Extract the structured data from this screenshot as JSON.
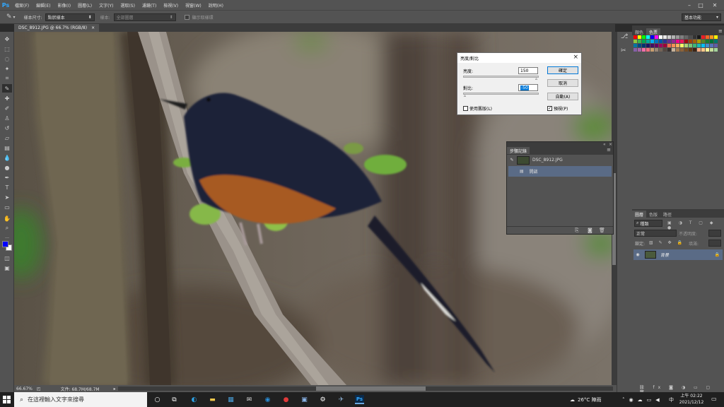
{
  "app": {
    "logo": "Ps"
  },
  "menu": [
    "檔案(F)",
    "編輯(E)",
    "影像(I)",
    "圖層(L)",
    "文字(Y)",
    "選取(S)",
    "濾鏡(T)",
    "檢視(V)",
    "視窗(W)",
    "說明(H)"
  ],
  "window_controls": {
    "minimize": "–",
    "maximize": "□",
    "close": "✕"
  },
  "options_bar": {
    "sample_size_label": "樣本尺寸:",
    "sample_size_value": "點狀樣本",
    "sample_label": "樣本:",
    "sample_value": "全部圖層",
    "show_ring_label": "顯示取樣環",
    "workspace": "基本功能"
  },
  "document_tab": {
    "title": "DSC_8912.JPG @ 66.7% (RGB/8)",
    "close": "×"
  },
  "status": {
    "zoom": "66.67%",
    "doc_info": "文件: 68.7M/68.7M"
  },
  "swatches_panel": {
    "tabs": [
      "顏色",
      "色票"
    ]
  },
  "swatch_colors": [
    "#ff0000",
    "#ffff00",
    "#00ff00",
    "#00ffff",
    "#0000ff",
    "#ff00ff",
    "#ffffff",
    "#e6e6e6",
    "#cccccc",
    "#b3b3b3",
    "#999999",
    "#808080",
    "#666666",
    "#4d4d4d",
    "#333333",
    "#1a1a1a",
    "#ed1c24",
    "#f26522",
    "#f7941d",
    "#fff200",
    "#8dc63f",
    "#39b54a",
    "#00a651",
    "#00a99d",
    "#00aeef",
    "#0072bc",
    "#0054a6",
    "#2e3192",
    "#662d91",
    "#92278f",
    "#ec008c",
    "#ed145b",
    "#9e0b0f",
    "#a0410d",
    "#a36209",
    "#aba000",
    "#598527",
    "#1a7b30",
    "#007236",
    "#00746b",
    "#0076a3",
    "#004b80",
    "#003471",
    "#1b1464",
    "#440e62",
    "#630460",
    "#9e005d",
    "#9e0039",
    "#f26c4f",
    "#f68e56",
    "#fbaf5d",
    "#fff568",
    "#acd373",
    "#7cc576",
    "#3bb878",
    "#1abbb4",
    "#00bff3",
    "#438ccb",
    "#5574b9",
    "#605ca8",
    "#8560a8",
    "#a763a8",
    "#f06ea9",
    "#f26d7d",
    "#c69c6e",
    "#998675",
    "#736357",
    "#534741",
    "#362f2d",
    "#c7b299",
    "#a67c52",
    "#8c6239",
    "#754c24",
    "#603913",
    "#3c2415",
    "#f9ad81",
    "#fdc689",
    "#fff799",
    "#c4df9b",
    "#a3d39c"
  ],
  "layers_panel": {
    "tabs": [
      "圖層",
      "色版",
      "路徑"
    ],
    "kind_filter": "種類",
    "blend_mode": "正常",
    "opacity_label": "不透明度:",
    "lock_label": "鎖定:",
    "fill_label": "填滿:",
    "layer_name": "背景"
  },
  "history_panel": {
    "tab": "步驟記錄",
    "snapshot_name": "DSC_8912.JPG",
    "step_name": "開啟"
  },
  "dialog": {
    "title": "亮度/對比",
    "brightness_label": "亮度:",
    "brightness_value": "150",
    "contrast_label": "對比:",
    "contrast_value": "-50",
    "ok": "確定",
    "cancel": "取消",
    "auto": "自動(A)",
    "legacy_label": "使用舊版(L)",
    "legacy_checked": false,
    "preview_label": "預視(P)",
    "preview_checked": true,
    "brightness_fraction": 1.0,
    "contrast_fraction": 0.0
  },
  "foreground_color": "#0000ff",
  "background_color": "#ffffff",
  "taskbar": {
    "search_placeholder": "在這裡輸入文字來搜尋",
    "weather": "26°C 陣雨",
    "ime": "中",
    "time": "上午 02:22",
    "date": "2021/12/12"
  }
}
